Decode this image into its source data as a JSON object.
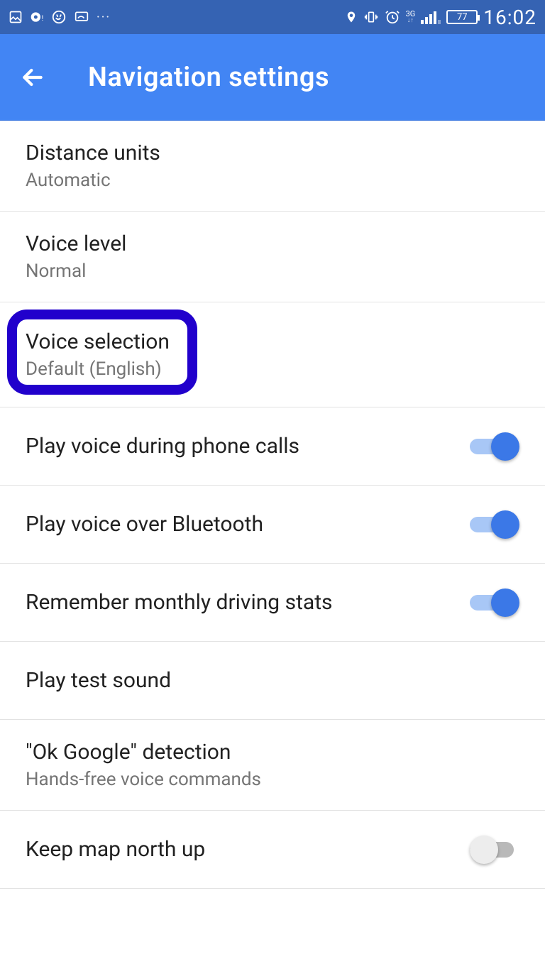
{
  "status": {
    "battery": "77",
    "time": "16:02",
    "network_label": "3G"
  },
  "appbar": {
    "title": "Navigation settings"
  },
  "settings": {
    "distance_units": {
      "title": "Distance units",
      "value": "Automatic"
    },
    "voice_level": {
      "title": "Voice level",
      "value": "Normal"
    },
    "voice_selection": {
      "title": "Voice selection",
      "value": "Default (English)"
    },
    "play_voice_calls": {
      "title": "Play voice during phone calls",
      "on": true
    },
    "play_voice_bt": {
      "title": "Play voice over Bluetooth",
      "on": true
    },
    "remember_stats": {
      "title": "Remember monthly driving stats",
      "on": true
    },
    "play_test_sound": {
      "title": "Play test sound"
    },
    "ok_google": {
      "title": "\"Ok Google\" detection",
      "value": "Hands-free voice commands"
    },
    "keep_north": {
      "title": "Keep map north up",
      "on": false
    }
  }
}
